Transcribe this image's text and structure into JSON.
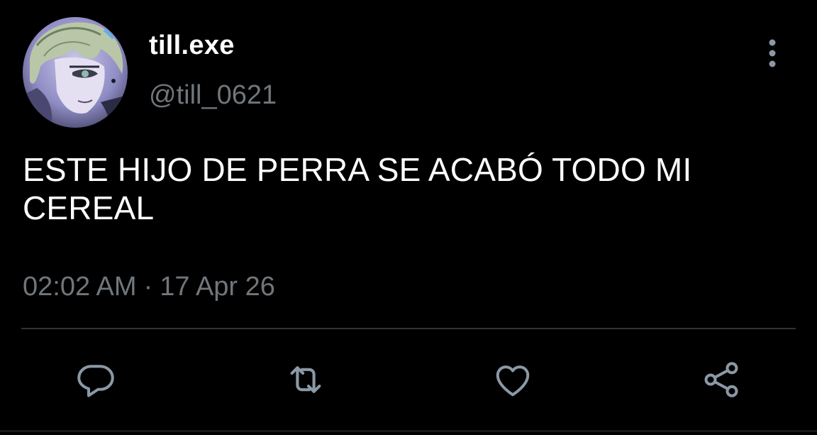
{
  "tweet": {
    "author": {
      "display_name": "till.exe",
      "handle": "@till_0621",
      "avatar_icon": "anime-character-avatar"
    },
    "text": "ESTE HIJO DE PERRA SE ACABÓ TODO MI CEREAL",
    "time": "02:02 AM",
    "separator": "·",
    "date": "17 Apr 26"
  },
  "actions": {
    "reply_icon": "speech-bubble-icon",
    "retweet_icon": "retweet-icon",
    "like_icon": "heart-icon",
    "share_icon": "share-icon",
    "more_icon": "vertical-dots-icon"
  },
  "colors": {
    "background": "#000000",
    "primary_text": "#ffffff",
    "secondary_text": "#71767b",
    "icon": "#8b98a5",
    "divider": "#2f3336"
  }
}
